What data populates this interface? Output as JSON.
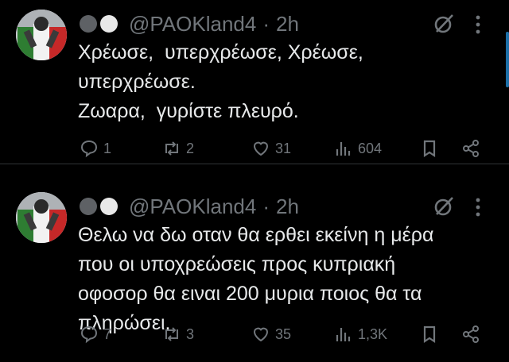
{
  "tweets": [
    {
      "handle": "@PAOKland4",
      "separator": "·",
      "time": "2h",
      "text": "Χρέωσε,  υπερχρέωσε, Χρέωσε,\nυπερχρέωσε.\nΖωαρα,  γυρίστε πλευρό.",
      "replies": "1",
      "reposts": "2",
      "likes": "31",
      "views": "604"
    },
    {
      "handle": "@PAOKland4",
      "separator": "·",
      "time": "2h",
      "text": "Θελω να δω οταν θα ερθει εκείνη η μέρα\nπου οι υποχρεώσεις προς κυπριακή\nοφοσορ θα ειναι 200 μυρια ποιος θα τα\nπληρώσει.",
      "replies": "7",
      "reposts": "3",
      "likes": "35",
      "views": "1,3K"
    }
  ],
  "icons": {
    "reply": "reply-icon",
    "repost": "repost-icon",
    "like": "like-icon",
    "views": "views-icon",
    "bookmark": "bookmark-icon",
    "share": "share-icon",
    "grok": "grok-icon",
    "more": "more-icon"
  },
  "colors": {
    "background": "#000000",
    "text": "#e7e9ea",
    "secondary": "#71767b",
    "divider": "#2f3336",
    "scrollbar": "#1d6fa8"
  }
}
